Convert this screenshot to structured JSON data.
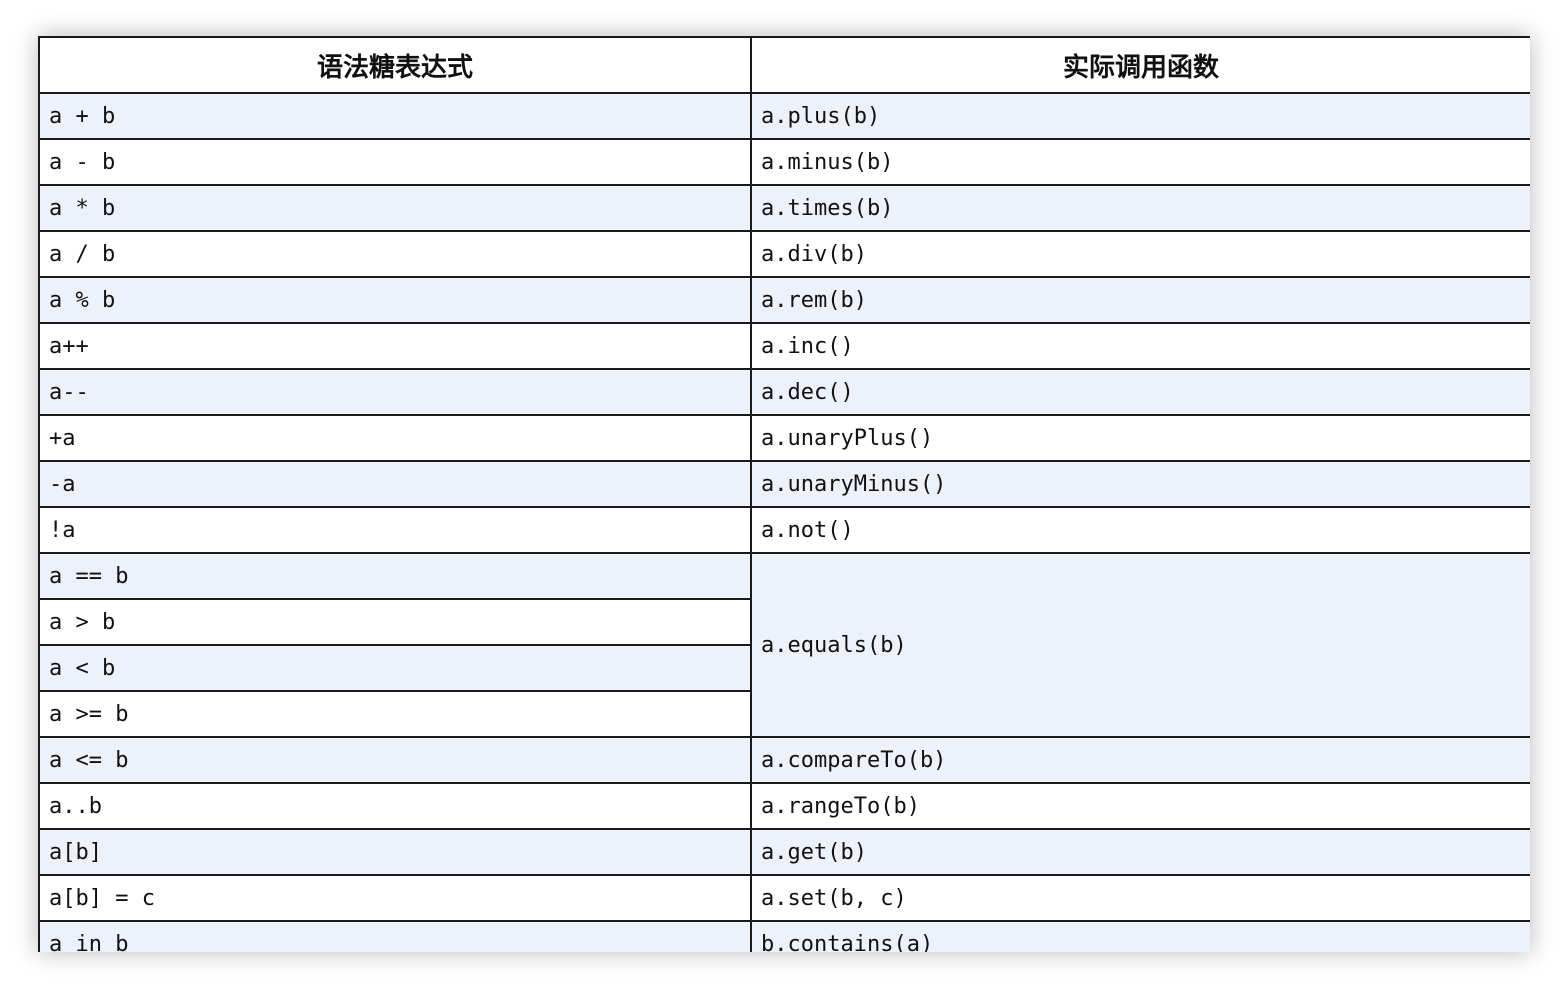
{
  "table": {
    "headers": [
      "语法糖表达式",
      "实际调用函数"
    ],
    "rows": [
      {
        "expr": "a + b",
        "call": "a.plus(b)"
      },
      {
        "expr": "a - b",
        "call": "a.minus(b)"
      },
      {
        "expr": "a * b",
        "call": "a.times(b)"
      },
      {
        "expr": "a / b",
        "call": "a.div(b)"
      },
      {
        "expr": "a % b",
        "call": "a.rem(b)"
      },
      {
        "expr": "a++",
        "call": "a.inc()"
      },
      {
        "expr": "a--",
        "call": "a.dec()"
      },
      {
        "expr": "+a",
        "call": "a.unaryPlus()"
      },
      {
        "expr": "-a",
        "call": "a.unaryMinus()"
      },
      {
        "expr": "!a",
        "call": "a.not()"
      },
      {
        "expr": "a == b",
        "call": "a.equals(b)"
      },
      {
        "expr": "a > b"
      },
      {
        "expr": "a < b"
      },
      {
        "expr": "a >= b"
      },
      {
        "expr": "a <= b",
        "call": "a.compareTo(b)"
      },
      {
        "expr": "a..b",
        "call": "a.rangeTo(b)"
      },
      {
        "expr": "a[b]",
        "call": "a.get(b)"
      },
      {
        "expr": "a[b] = c",
        "call": "a.set(b, c)"
      },
      {
        "expr": "a in b",
        "call": "b.contains(a)"
      }
    ]
  }
}
